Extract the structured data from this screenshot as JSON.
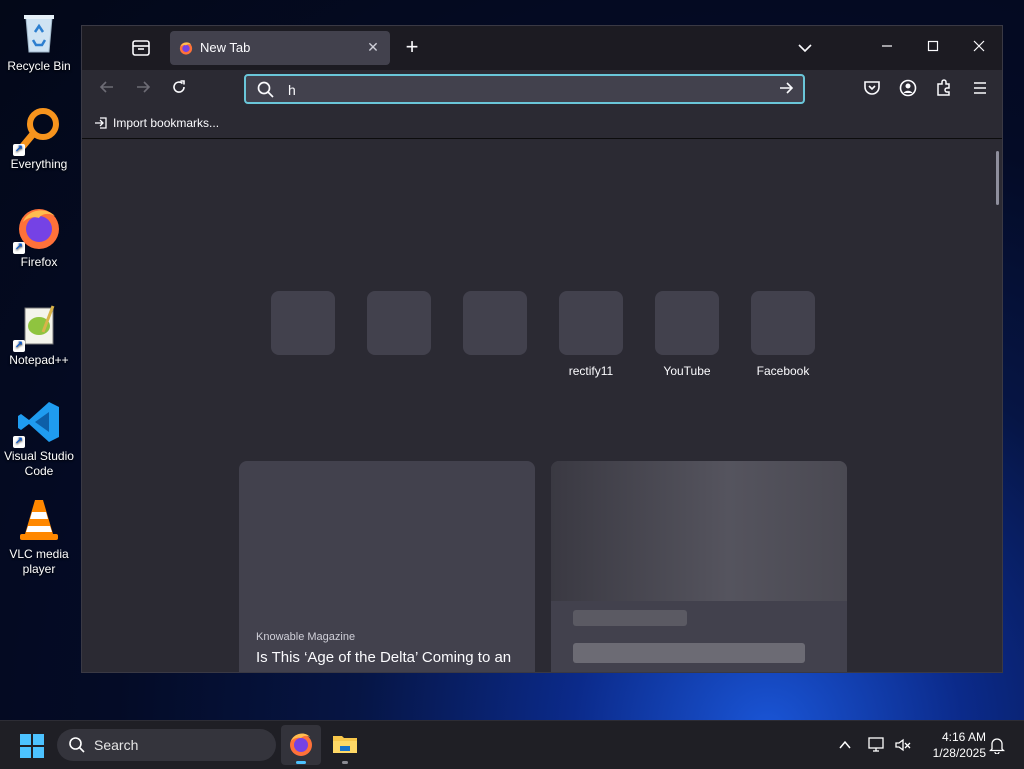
{
  "desktop": {
    "icons": [
      {
        "label": "Recycle Bin"
      },
      {
        "label": "Everything"
      },
      {
        "label": "Firefox"
      },
      {
        "label": "Notepad++"
      },
      {
        "label": "Visual Studio Code"
      },
      {
        "label": "VLC media player"
      }
    ]
  },
  "browser": {
    "tab": {
      "title": "New Tab"
    },
    "urlbar": {
      "value": "h",
      "placeholder": ""
    },
    "bookmarks": {
      "import_label": "Import bookmarks..."
    },
    "shortcuts": [
      {
        "label": ""
      },
      {
        "label": ""
      },
      {
        "label": ""
      },
      {
        "label": "rectify11"
      },
      {
        "label": "YouTube"
      },
      {
        "label": "Facebook"
      }
    ],
    "stories": [
      {
        "source": "Knowable Magazine",
        "headline": "Is This ‘Age of the Delta’ Coming to an"
      }
    ]
  },
  "taskbar": {
    "search_label": "Search",
    "clock": {
      "time": "4:16 AM",
      "date": "1/28/2025"
    }
  },
  "colors": {
    "accent": "#6ac6d9",
    "windows_accent": "#4cc2ff",
    "tab_bg": "#42414d",
    "content_bg": "#2b2a33"
  }
}
